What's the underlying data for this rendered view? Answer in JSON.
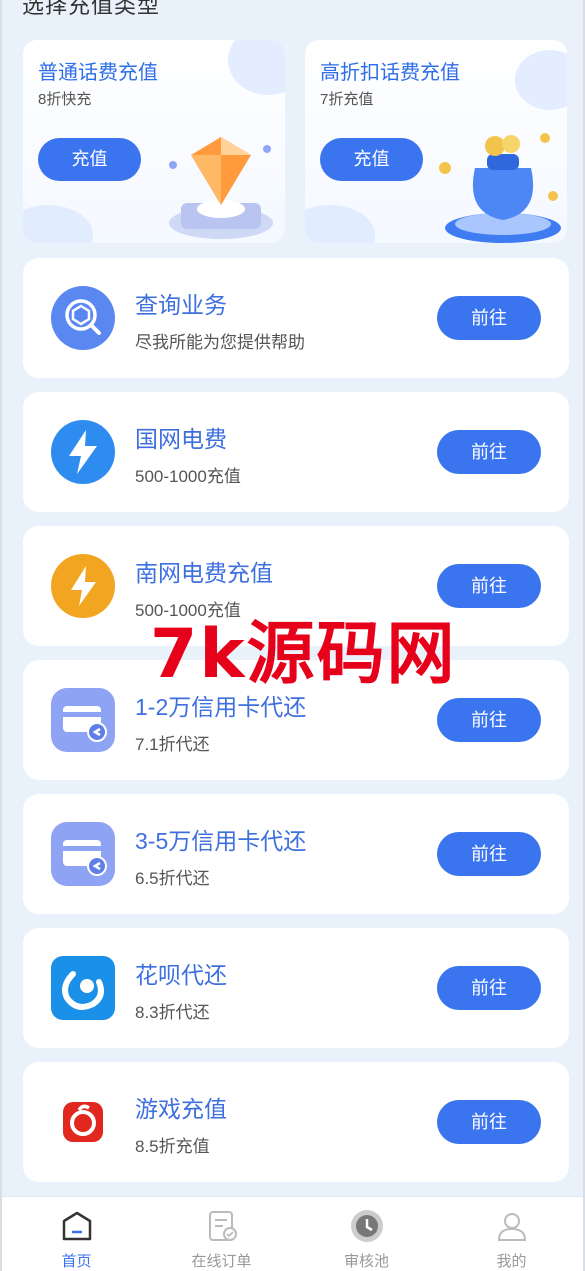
{
  "section_title": "选择充值类型",
  "promos": [
    {
      "title": "普通话费充值",
      "subtitle": "8折快充",
      "button": "充值"
    },
    {
      "title": "高折扣话费充值",
      "subtitle": "7折充值",
      "button": "充值"
    }
  ],
  "services": [
    {
      "title": "查询业务",
      "subtitle": "尽我所能为您提供帮助",
      "button": "前往",
      "icon": "search-cube-icon"
    },
    {
      "title": "国网电费",
      "subtitle": "500-1000充值",
      "button": "前往",
      "icon": "lightning-blue-icon"
    },
    {
      "title": "南网电费充值",
      "subtitle": "500-1000充值",
      "button": "前往",
      "icon": "lightning-orange-icon"
    },
    {
      "title": "1-2万信用卡代还",
      "subtitle": "7.1折代还",
      "button": "前往",
      "icon": "credit-card-icon"
    },
    {
      "title": "3-5万信用卡代还",
      "subtitle": "6.5折代还",
      "button": "前往",
      "icon": "credit-card-icon"
    },
    {
      "title": "花呗代还",
      "subtitle": "8.3折代还",
      "button": "前往",
      "icon": "huabei-icon"
    },
    {
      "title": "游戏充值",
      "subtitle": "8.5折充值",
      "button": "前往",
      "icon": "game-icon"
    }
  ],
  "watermark": "7k源码网",
  "tabs": [
    {
      "label": "首页",
      "icon": "home-icon",
      "active": true
    },
    {
      "label": "在线订单",
      "icon": "order-icon",
      "active": false
    },
    {
      "label": "审核池",
      "icon": "clock-icon",
      "active": false
    },
    {
      "label": "我的",
      "icon": "user-icon",
      "active": false
    }
  ],
  "colors": {
    "accent": "#3a74ef",
    "title_blue": "#3e6fdf",
    "background": "#e9f1fb",
    "watermark": "#e6001a"
  }
}
